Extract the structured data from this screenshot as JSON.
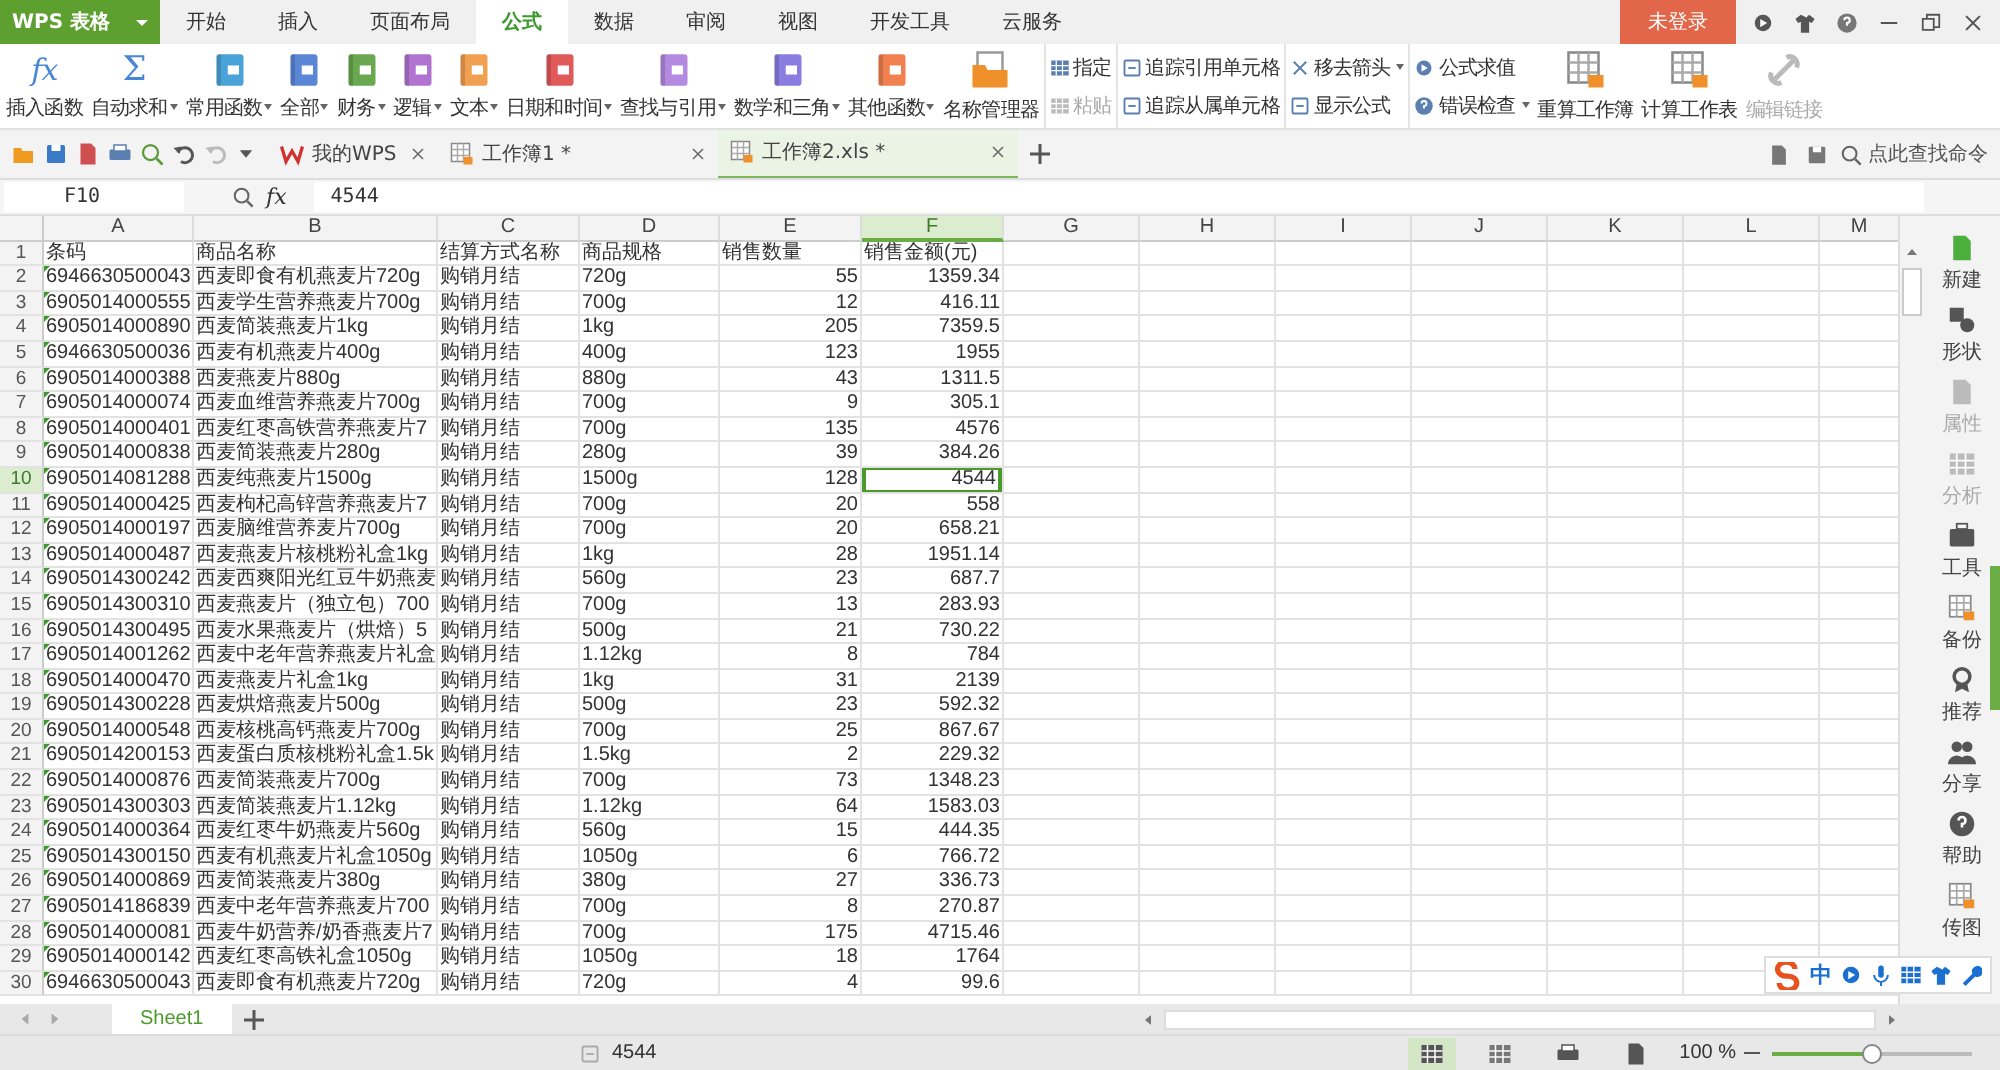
{
  "app_button": {
    "label": "WPS 表格"
  },
  "menu_tabs": [
    {
      "label": "开始",
      "selected": false
    },
    {
      "label": "插入",
      "selected": false
    },
    {
      "label": "页面布局",
      "selected": false
    },
    {
      "label": "公式",
      "selected": true
    },
    {
      "label": "数据",
      "selected": false
    },
    {
      "label": "审阅",
      "selected": false
    },
    {
      "label": "视图",
      "selected": false
    },
    {
      "label": "开发工具",
      "selected": false
    },
    {
      "label": "云服务",
      "selected": false
    }
  ],
  "login_button": {
    "label": "未登录"
  },
  "ribbon": [
    {
      "kind": "large",
      "label": "插入函数",
      "glyph": "fx",
      "caret": false
    },
    {
      "kind": "large",
      "label": "自动求和",
      "glyph": "Σ",
      "caret": true
    },
    {
      "kind": "large",
      "label": "常用函数",
      "color": "#4aa3d8",
      "caret": true
    },
    {
      "kind": "large",
      "label": "全部",
      "color": "#5b86d6",
      "caret": true
    },
    {
      "kind": "large",
      "label": "财务",
      "color": "#6aa84f",
      "caret": true
    },
    {
      "kind": "large",
      "label": "逻辑",
      "color": "#b074d0",
      "caret": true
    },
    {
      "kind": "large",
      "label": "文本",
      "color": "#f0a050",
      "caret": true
    },
    {
      "kind": "large",
      "label": "日期和时间",
      "color": "#e05a5a",
      "caret": true
    },
    {
      "kind": "large",
      "label": "查找与引用",
      "color": "#b48ae0",
      "caret": true
    },
    {
      "kind": "large",
      "label": "数学和三角",
      "color": "#8a7de0",
      "caret": true
    },
    {
      "kind": "large",
      "label": "其他函数",
      "color": "#f08050",
      "caret": true
    },
    {
      "kind": "large",
      "label": "名称管理器",
      "caret": false,
      "folder": true
    },
    {
      "kind": "stack",
      "items": [
        {
          "label": "指定",
          "caret": false,
          "disabled": false
        },
        {
          "label": "粘贴",
          "caret": false,
          "disabled": true
        }
      ]
    },
    {
      "kind": "stack",
      "items": [
        {
          "label": "追踪引用单元格",
          "caret": false,
          "disabled": false
        },
        {
          "label": "追踪从属单元格",
          "caret": false,
          "disabled": false
        }
      ]
    },
    {
      "kind": "stack",
      "items": [
        {
          "label": "移去箭头",
          "caret": true,
          "disabled": false
        },
        {
          "label": "显示公式",
          "caret": false,
          "disabled": false
        }
      ]
    },
    {
      "kind": "stack",
      "items": [
        {
          "label": "公式求值",
          "caret": false,
          "disabled": false
        },
        {
          "label": "错误检查",
          "caret": true,
          "disabled": false
        }
      ]
    },
    {
      "kind": "large",
      "label": "重算工作簿",
      "caret": false,
      "sheet": true
    },
    {
      "kind": "large",
      "label": "计算工作表",
      "caret": false,
      "sheet": true
    },
    {
      "kind": "large",
      "label": "编辑链接",
      "caret": false,
      "disabled": true,
      "link": true
    }
  ],
  "doc_tabs": [
    {
      "label": "我的WPS",
      "selected": false,
      "kind": "home"
    },
    {
      "label": "工作簿1 *",
      "selected": false,
      "kind": "sheet"
    },
    {
      "label": "工作簿2.xls *",
      "selected": true,
      "kind": "sheet"
    }
  ],
  "command_search": {
    "placeholder": "点此查找命令"
  },
  "formula_bar": {
    "cell": "F10",
    "fx": "fx",
    "value": "4544"
  },
  "table": {
    "columns": [
      {
        "label": "A",
        "kind": "code",
        "selected": false
      },
      {
        "label": "B",
        "kind": "text",
        "selected": false
      },
      {
        "label": "C",
        "kind": "text",
        "selected": false
      },
      {
        "label": "D",
        "kind": "text",
        "selected": false
      },
      {
        "label": "E",
        "kind": "number",
        "selected": false
      },
      {
        "label": "F",
        "kind": "number",
        "selected": true
      },
      {
        "label": "G",
        "kind": "text",
        "selected": false
      },
      {
        "label": "H",
        "kind": "text",
        "selected": false
      },
      {
        "label": "I",
        "kind": "text",
        "selected": false
      },
      {
        "label": "J",
        "kind": "text",
        "selected": false
      },
      {
        "label": "K",
        "kind": "text",
        "selected": false
      },
      {
        "label": "L",
        "kind": "text",
        "selected": false
      },
      {
        "label": "M",
        "kind": "text",
        "selected": false
      }
    ],
    "rows": [
      {
        "number": "1",
        "kind": "header",
        "selected": false,
        "cells": [
          "条码",
          "商品名称",
          "结算方式名称",
          "商品规格",
          "销售数量",
          "销售金额(元)"
        ]
      },
      {
        "number": "2",
        "kind": "data",
        "selected": false,
        "cells": [
          "6946630500043",
          "西麦即食有机燕麦片720g",
          "购销月结",
          "720g",
          "55",
          "1359.34"
        ]
      },
      {
        "number": "3",
        "kind": "data",
        "selected": false,
        "cells": [
          "6905014000555",
          "西麦学生营养燕麦片700g",
          "购销月结",
          "700g",
          "12",
          "416.11"
        ]
      },
      {
        "number": "4",
        "kind": "data",
        "selected": false,
        "cells": [
          "6905014000890",
          "西麦简装燕麦片1kg",
          "购销月结",
          "1kg",
          "205",
          "7359.5"
        ]
      },
      {
        "number": "5",
        "kind": "data",
        "selected": false,
        "cells": [
          "6946630500036",
          "西麦有机燕麦片400g",
          "购销月结",
          "400g",
          "123",
          "1955"
        ]
      },
      {
        "number": "6",
        "kind": "data",
        "selected": false,
        "cells": [
          "6905014000388",
          "西麦燕麦片880g",
          "购销月结",
          "880g",
          "43",
          "1311.5"
        ]
      },
      {
        "number": "7",
        "kind": "data",
        "selected": false,
        "cells": [
          "6905014000074",
          "西麦血维营养燕麦片700g",
          "购销月结",
          "700g",
          "9",
          "305.1"
        ]
      },
      {
        "number": "8",
        "kind": "data",
        "selected": false,
        "cells": [
          "6905014000401",
          "西麦红枣高铁营养燕麦片7",
          "购销月结",
          "700g",
          "135",
          "4576"
        ]
      },
      {
        "number": "9",
        "kind": "data",
        "selected": false,
        "cells": [
          "6905014000838",
          "西麦简装燕麦片280g",
          "购销月结",
          "280g",
          "39",
          "384.26"
        ]
      },
      {
        "number": "10",
        "kind": "data",
        "selected": true,
        "cells": [
          "6905014081288",
          "西麦纯燕麦片1500g",
          "购销月结",
          "1500g",
          "128",
          "4544"
        ]
      },
      {
        "number": "11",
        "kind": "data",
        "selected": false,
        "cells": [
          "6905014000425",
          "西麦枸杞高锌营养燕麦片7",
          "购销月结",
          "700g",
          "20",
          "558"
        ]
      },
      {
        "number": "12",
        "kind": "data",
        "selected": false,
        "cells": [
          "6905014000197",
          "西麦脑维营养麦片700g",
          "购销月结",
          "700g",
          "20",
          "658.21"
        ]
      },
      {
        "number": "13",
        "kind": "data",
        "selected": false,
        "cells": [
          "6905014000487",
          "西麦燕麦片核桃粉礼盒1kg",
          "购销月结",
          "1kg",
          "28",
          "1951.14"
        ]
      },
      {
        "number": "14",
        "kind": "data",
        "selected": false,
        "cells": [
          "6905014300242",
          "西麦西爽阳光红豆牛奶燕麦",
          "购销月结",
          "560g",
          "23",
          "687.7"
        ]
      },
      {
        "number": "15",
        "kind": "data",
        "selected": false,
        "cells": [
          "6905014300310",
          "西麦燕麦片（独立包）700",
          "购销月结",
          "700g",
          "13",
          "283.93"
        ]
      },
      {
        "number": "16",
        "kind": "data",
        "selected": false,
        "cells": [
          "6905014300495",
          "西麦水果燕麦片（烘焙）5",
          "购销月结",
          "500g",
          "21",
          "730.22"
        ]
      },
      {
        "number": "17",
        "kind": "data",
        "selected": false,
        "cells": [
          "6905014001262",
          "西麦中老年营养燕麦片礼盒",
          "购销月结",
          "1.12kg",
          "8",
          "784"
        ]
      },
      {
        "number": "18",
        "kind": "data",
        "selected": false,
        "cells": [
          "6905014000470",
          "西麦燕麦片礼盒1kg",
          "购销月结",
          "1kg",
          "31",
          "2139"
        ]
      },
      {
        "number": "19",
        "kind": "data",
        "selected": false,
        "cells": [
          "6905014300228",
          "西麦烘焙燕麦片500g",
          "购销月结",
          "500g",
          "23",
          "592.32"
        ]
      },
      {
        "number": "20",
        "kind": "data",
        "selected": false,
        "cells": [
          "6905014000548",
          "西麦核桃高钙燕麦片700g",
          "购销月结",
          "700g",
          "25",
          "867.67"
        ]
      },
      {
        "number": "21",
        "kind": "data",
        "selected": false,
        "cells": [
          "6905014200153",
          "西麦蛋白质核桃粉礼盒1.5k",
          "购销月结",
          "1.5kg",
          "2",
          "229.32"
        ]
      },
      {
        "number": "22",
        "kind": "data",
        "selected": false,
        "cells": [
          "6905014000876",
          "西麦简装燕麦片700g",
          "购销月结",
          "700g",
          "73",
          "1348.23"
        ]
      },
      {
        "number": "23",
        "kind": "data",
        "selected": false,
        "cells": [
          "6905014300303",
          "西麦简装燕麦片1.12kg",
          "购销月结",
          "1.12kg",
          "64",
          "1583.03"
        ]
      },
      {
        "number": "24",
        "kind": "data",
        "selected": false,
        "cells": [
          "6905014000364",
          "西麦红枣牛奶燕麦片560g",
          "购销月结",
          "560g",
          "15",
          "444.35"
        ]
      },
      {
        "number": "25",
        "kind": "data",
        "selected": false,
        "cells": [
          "6905014300150",
          "西麦有机燕麦片礼盒1050g",
          "购销月结",
          "1050g",
          "6",
          "766.72"
        ]
      },
      {
        "number": "26",
        "kind": "data",
        "selected": false,
        "cells": [
          "6905014000869",
          "西麦简装燕麦片380g",
          "购销月结",
          "380g",
          "27",
          "336.73"
        ]
      },
      {
        "number": "27",
        "kind": "data",
        "selected": false,
        "cells": [
          "6905014186839",
          "西麦中老年营养燕麦片700",
          "购销月结",
          "700g",
          "8",
          "270.87"
        ]
      },
      {
        "number": "28",
        "kind": "data",
        "selected": false,
        "cells": [
          "6905014000081",
          "西麦牛奶营养/奶香燕麦片7",
          "购销月结",
          "700g",
          "175",
          "4715.46"
        ]
      },
      {
        "number": "29",
        "kind": "data",
        "selected": false,
        "cells": [
          "6905014000142",
          "西麦红枣高铁礼盒1050g",
          "购销月结",
          "1050g",
          "18",
          "1764"
        ]
      },
      {
        "number": "30",
        "kind": "data",
        "selected": false,
        "cells": [
          "6946630500043",
          "西麦即食有机燕麦片720g",
          "购销月结",
          "720g",
          "4",
          "99.6"
        ]
      }
    ]
  },
  "side_panel": [
    {
      "label": "新建",
      "disabled": false
    },
    {
      "label": "形状",
      "disabled": false
    },
    {
      "label": "属性",
      "disabled": true
    },
    {
      "label": "分析",
      "disabled": true
    },
    {
      "label": "工具",
      "disabled": false
    },
    {
      "label": "备份",
      "disabled": false
    },
    {
      "label": "推荐",
      "disabled": false
    },
    {
      "label": "分享",
      "disabled": false
    },
    {
      "label": "帮助",
      "disabled": false
    },
    {
      "label": "传图",
      "disabled": false
    }
  ],
  "ime_toolbar": {
    "mode": "中"
  },
  "sheet_tabs": [
    {
      "label": "Sheet1",
      "selected": true
    }
  ],
  "status_bar": {
    "value": "4544",
    "zoom": "100 %",
    "zoom_slider": {
      "level": 0.5
    }
  }
}
